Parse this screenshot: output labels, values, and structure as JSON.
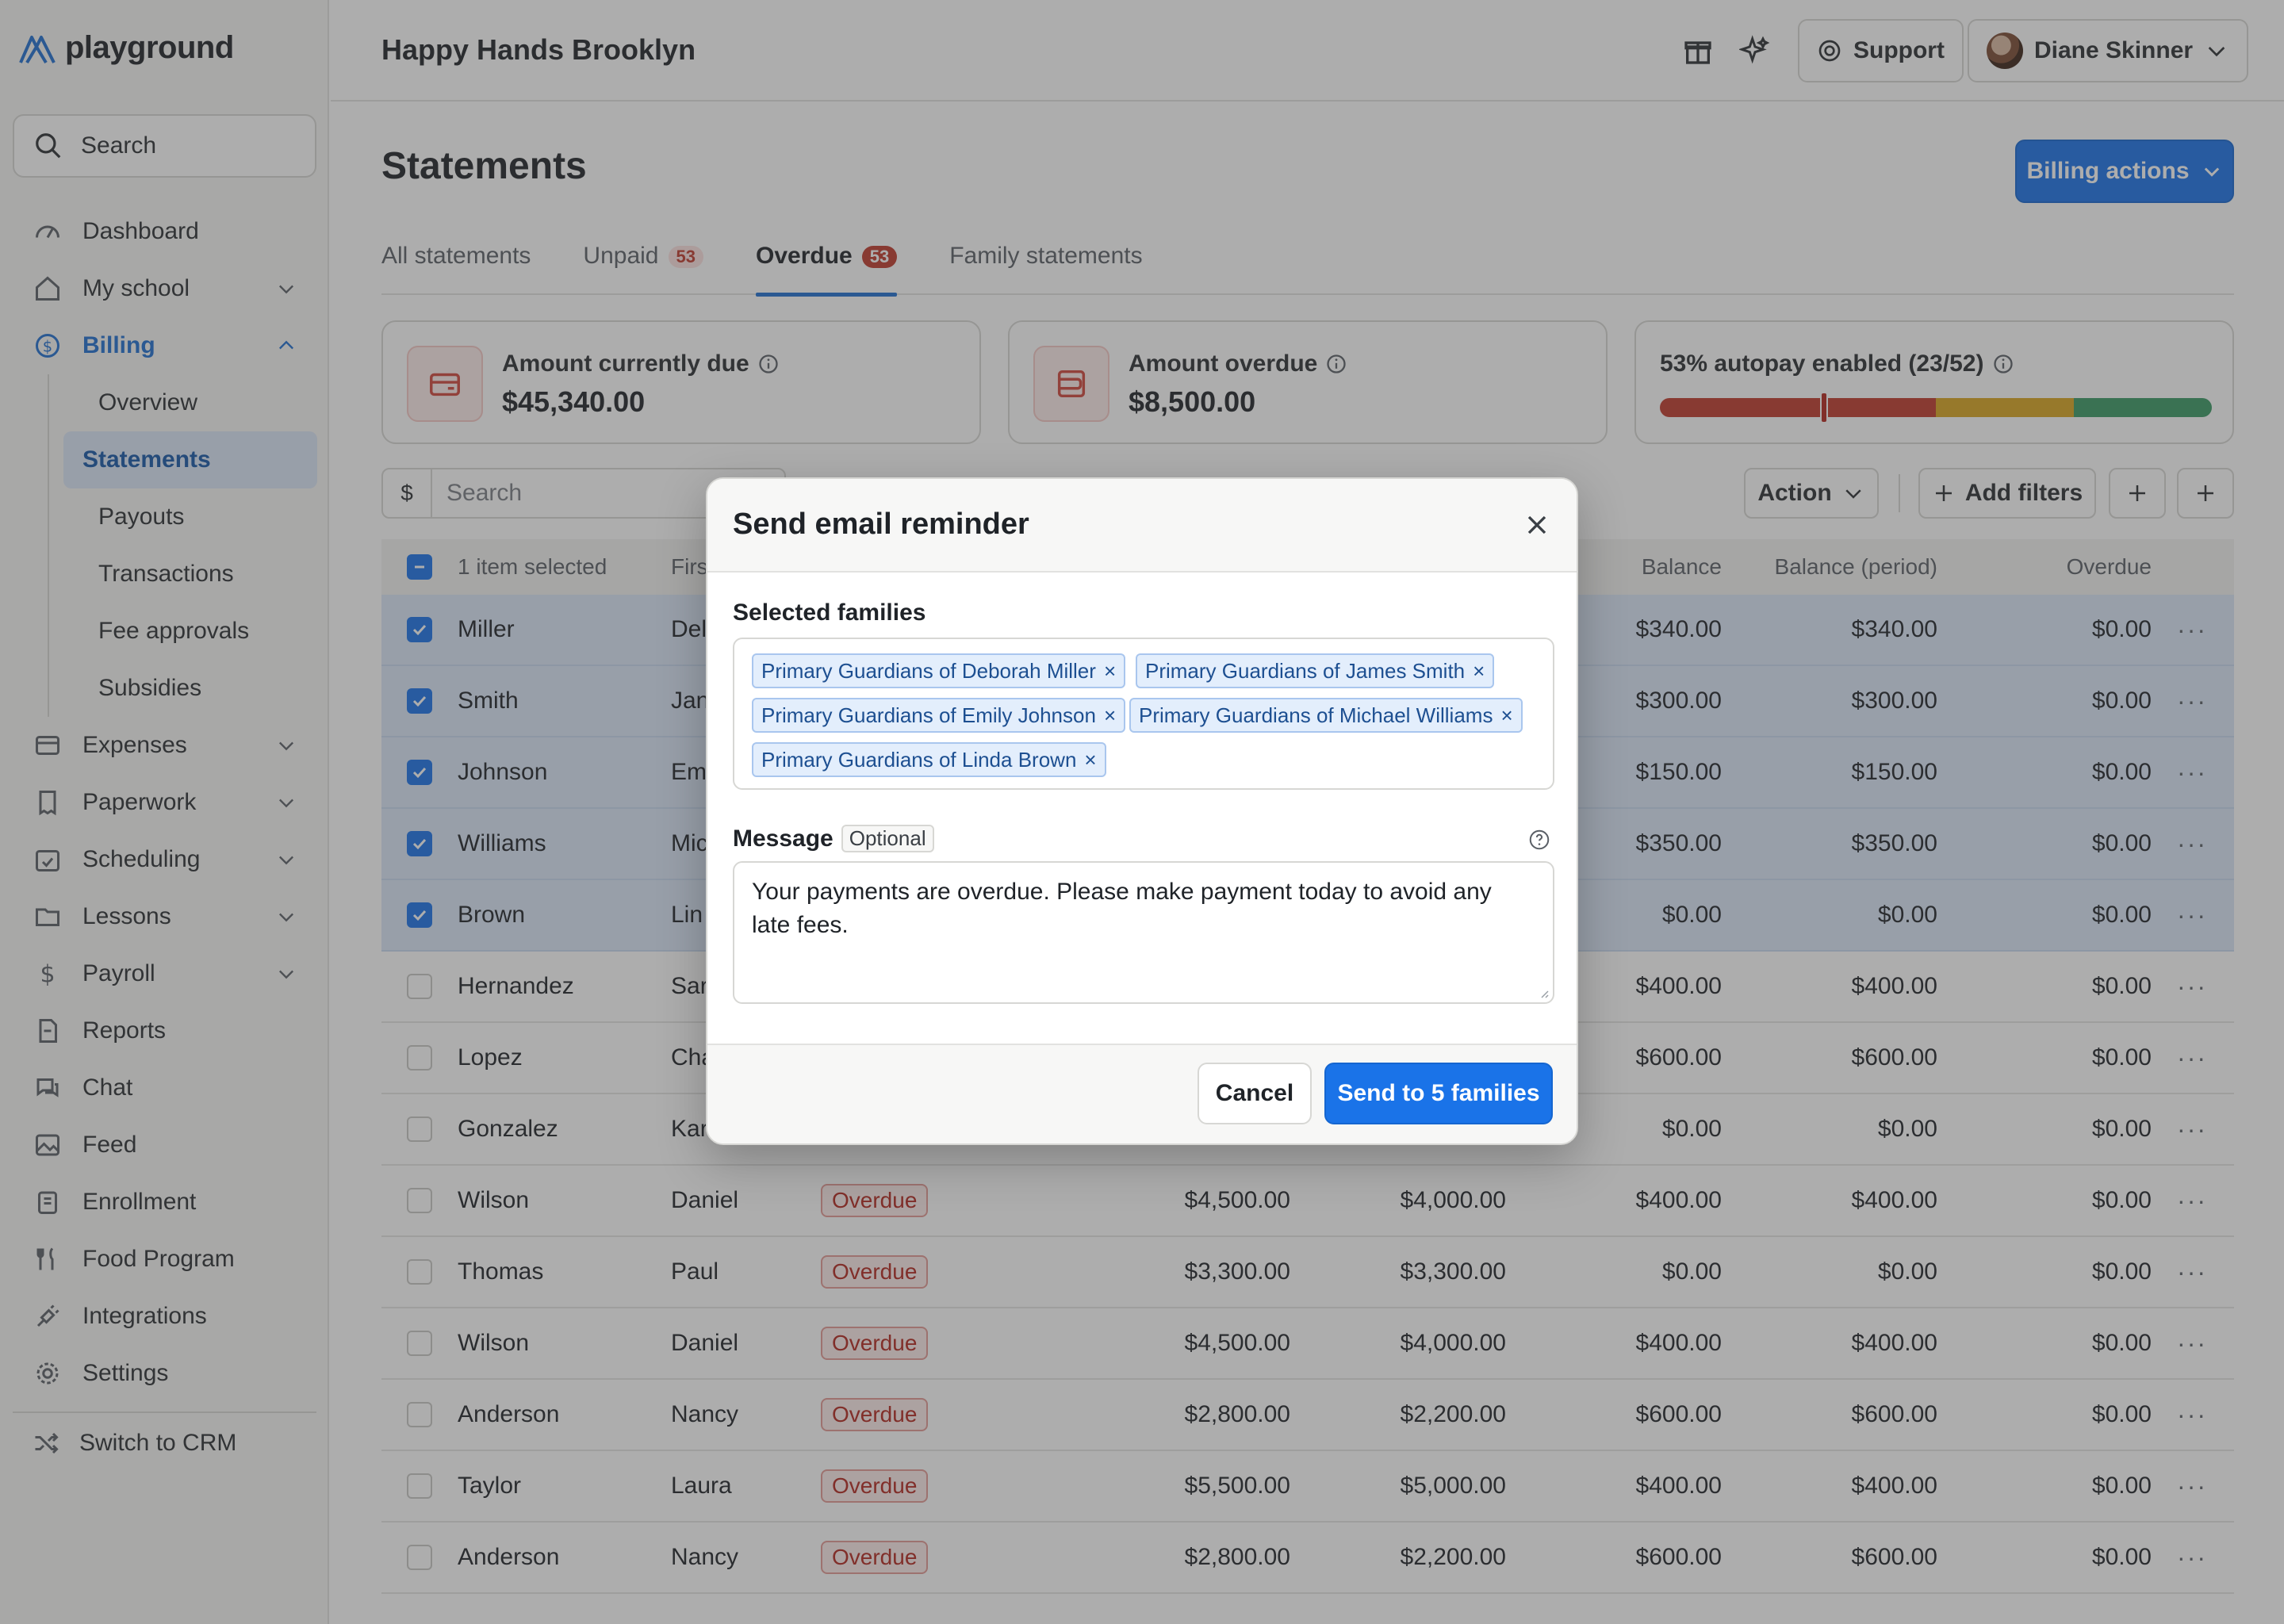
{
  "app": {
    "logo_text": "playground",
    "school_name": "Happy Hands Brooklyn"
  },
  "sidebar": {
    "search_label": "Search",
    "items": [
      {
        "label": "Dashboard",
        "icon": "speedometer-icon"
      },
      {
        "label": "My school",
        "icon": "home-icon"
      },
      {
        "label": "Billing",
        "icon": "dollar-circle-icon"
      },
      {
        "label": "Expenses",
        "icon": "card-icon"
      },
      {
        "label": "Paperwork",
        "icon": "receipt-icon"
      },
      {
        "label": "Scheduling",
        "icon": "calendar-check-icon"
      },
      {
        "label": "Lessons",
        "icon": "folder-icon"
      },
      {
        "label": "Payroll",
        "icon": "dollar-icon"
      },
      {
        "label": "Reports",
        "icon": "report-icon"
      },
      {
        "label": "Chat",
        "icon": "chat-icon"
      },
      {
        "label": "Feed",
        "icon": "image-icon"
      },
      {
        "label": "Enrollment",
        "icon": "building-icon"
      },
      {
        "label": "Food Program",
        "icon": "fork-knife-icon"
      },
      {
        "label": "Integrations",
        "icon": "plug-icon"
      },
      {
        "label": "Settings",
        "icon": "gear-icon"
      }
    ],
    "billing_sub": [
      "Overview",
      "Statements",
      "Payouts",
      "Transactions",
      "Fee approvals",
      "Subsidies"
    ],
    "switch_crm": "Switch to CRM"
  },
  "topbar": {
    "support_label": "Support",
    "user_name": "Diane Skinner"
  },
  "page": {
    "title": "Statements",
    "billing_actions": "Billing actions",
    "tabs": [
      {
        "label": "All statements"
      },
      {
        "label": "Unpaid",
        "count": "53"
      },
      {
        "label": "Overdue",
        "count": "53"
      },
      {
        "label": "Family statements"
      }
    ],
    "cards": {
      "due_label": "Amount currently due",
      "due_value": "$45,340.00",
      "overdue_label": "Amount overdue",
      "overdue_value": "$8,500.00",
      "autopay_label": "53% autopay enabled (23/52)",
      "autopay_fraction": 0.53
    },
    "toolbar": {
      "currency": "$",
      "search_placeholder": "Search",
      "action": "Action",
      "add_filters": "Add filters"
    }
  },
  "table": {
    "selection_text": "1 item selected",
    "columns": {
      "first": "Firs",
      "balance": "Balance",
      "balance_period": "Balance (period)",
      "overdue": "Overdue"
    },
    "rows": [
      {
        "last": "Miller",
        "first": "Del",
        "status": "",
        "a": "",
        "b": "",
        "balance": "$340.00",
        "period": "$340.00",
        "overdue": "$0.00",
        "selected": true
      },
      {
        "last": "Smith",
        "first": "Jan",
        "status": "",
        "a": "",
        "b": "",
        "balance": "$300.00",
        "period": "$300.00",
        "overdue": "$0.00",
        "selected": true
      },
      {
        "last": "Johnson",
        "first": "Em",
        "status": "",
        "a": "",
        "b": "",
        "balance": "$150.00",
        "period": "$150.00",
        "overdue": "$0.00",
        "selected": true
      },
      {
        "last": "Williams",
        "first": "Mic",
        "status": "",
        "a": "",
        "b": "",
        "balance": "$350.00",
        "period": "$350.00",
        "overdue": "$0.00",
        "selected": true
      },
      {
        "last": "Brown",
        "first": "Lin",
        "status": "",
        "a": "",
        "b": "",
        "balance": "$0.00",
        "period": "$0.00",
        "overdue": "$0.00",
        "selected": true
      },
      {
        "last": "Hernandez",
        "first": "Sar",
        "status": "",
        "a": "",
        "b": "",
        "balance": "$400.00",
        "period": "$400.00",
        "overdue": "$0.00",
        "selected": false
      },
      {
        "last": "Lopez",
        "first": "Cha",
        "status": "",
        "a": "",
        "b": "",
        "balance": "$600.00",
        "period": "$600.00",
        "overdue": "$0.00",
        "selected": false
      },
      {
        "last": "Gonzalez",
        "first": "Kar",
        "status": "",
        "a": "",
        "b": "",
        "balance": "$0.00",
        "period": "$0.00",
        "overdue": "$0.00",
        "selected": false
      },
      {
        "last": "Wilson",
        "first": "Daniel",
        "status": "Overdue",
        "a": "$4,500.00",
        "b": "$4,000.00",
        "balance": "$400.00",
        "period": "$400.00",
        "overdue": "$0.00",
        "selected": false
      },
      {
        "last": "Thomas",
        "first": "Paul",
        "status": "Overdue",
        "a": "$3,300.00",
        "b": "$3,300.00",
        "balance": "$0.00",
        "period": "$0.00",
        "overdue": "$0.00",
        "selected": false
      },
      {
        "last": "Wilson",
        "first": "Daniel",
        "status": "Overdue",
        "a": "$4,500.00",
        "b": "$4,000.00",
        "balance": "$400.00",
        "period": "$400.00",
        "overdue": "$0.00",
        "selected": false
      },
      {
        "last": "Anderson",
        "first": "Nancy",
        "status": "Overdue",
        "a": "$2,800.00",
        "b": "$2,200.00",
        "balance": "$600.00",
        "period": "$600.00",
        "overdue": "$0.00",
        "selected": false
      },
      {
        "last": "Taylor",
        "first": "Laura",
        "status": "Overdue",
        "a": "$5,500.00",
        "b": "$5,000.00",
        "balance": "$400.00",
        "period": "$400.00",
        "overdue": "$0.00",
        "selected": false
      },
      {
        "last": "Anderson",
        "first": "Nancy",
        "status": "Overdue",
        "a": "$2,800.00",
        "b": "$2,200.00",
        "balance": "$600.00",
        "period": "$600.00",
        "overdue": "$0.00",
        "selected": false
      }
    ]
  },
  "modal": {
    "title": "Send email reminder",
    "families_label": "Selected families",
    "chips": [
      "Primary Guardians of Deborah Miller",
      "Primary Guardians of James Smith",
      "Primary Guardians of Emily Johnson",
      "Primary Guardians of Michael Williams",
      "Primary Guardians of Linda Brown"
    ],
    "chip_remove": "×",
    "message_label": "Message",
    "optional_label": "Optional",
    "message_value": "Your payments are overdue. Please make payment today to avoid any late fees.",
    "cancel": "Cancel",
    "send": "Send to 5 families"
  },
  "colors": {
    "accent": "#1a73e8",
    "selected_row": "#dbe7f8",
    "overdue_red": "#b3261e",
    "autopay_segments": [
      "#c0392b",
      "#d9a520",
      "#3a9a64"
    ]
  }
}
